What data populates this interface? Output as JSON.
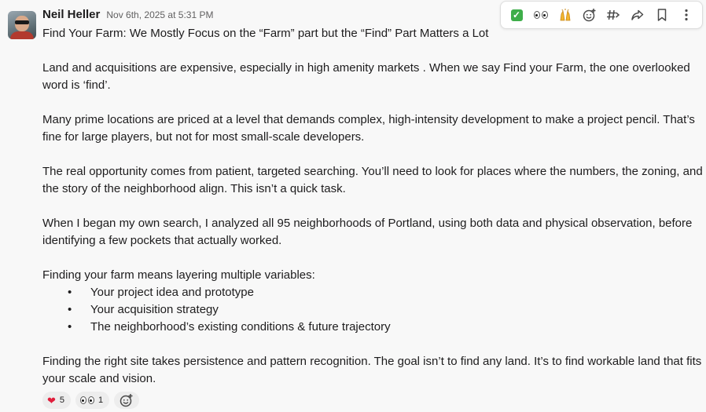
{
  "message": {
    "author": "Neil Heller",
    "timestamp": "Nov 6th, 2025 at 5:31 PM",
    "paragraphs": [
      "Find Your Farm: We Mostly Focus on the “Farm” part but the “Find” Part Matters a Lot",
      "Land and acquisitions are expensive, especially in high amenity markets . When we say Find your Farm, the one overlooked word is ‘find’.",
      "Many prime locations are priced at a level that demands complex, high-intensity development to make a project pencil. That’s fine for large players, but not for most small-scale developers.",
      "The real opportunity comes from patient, targeted searching. You’ll need to look for places where the numbers, the zoning, and the story of the neighborhood align. This isn’t a quick task.",
      "When I began my own search, I analyzed all 95 neighborhoods of Portland, using both data and physical observation, before identifying a few pockets that actually worked.",
      "Finding your farm means layering multiple variables:",
      "Finding the right site takes persistence and pattern recognition. The goal isn’t to find any land. It’s to find workable land that fits your scale and vision."
    ],
    "bullets": [
      "Your project idea and prototype",
      "Your acquisition strategy",
      "The neighborhood’s existing conditions & future trajectory"
    ],
    "bullet_glyph": "•"
  },
  "reactions": [
    {
      "emoji": "❤️",
      "name": "heart-emoji",
      "count": "5"
    },
    {
      "emoji": "eyes",
      "name": "eyes-emoji",
      "count": "1"
    }
  ],
  "toolbar": {
    "items": [
      {
        "name": "check-emoji-icon",
        "glyph": "✓"
      },
      {
        "name": "eyes-emoji-icon",
        "glyph": ""
      },
      {
        "name": "raised-hands-emoji-icon",
        "glyph": "🙌"
      },
      {
        "name": "add-reaction-icon",
        "glyph": "☺"
      },
      {
        "name": "reply-in-thread-icon",
        "glyph": "#"
      },
      {
        "name": "forward-icon",
        "glyph": "➦"
      },
      {
        "name": "bookmark-icon",
        "glyph": ""
      },
      {
        "name": "more-actions-icon",
        "glyph": "⋮"
      }
    ]
  },
  "colors": {
    "background": "#f8f8f8",
    "text": "#1d1c1d",
    "muted": "#616061",
    "check_green": "#3eae4a",
    "heart_red": "#e01e3c"
  }
}
